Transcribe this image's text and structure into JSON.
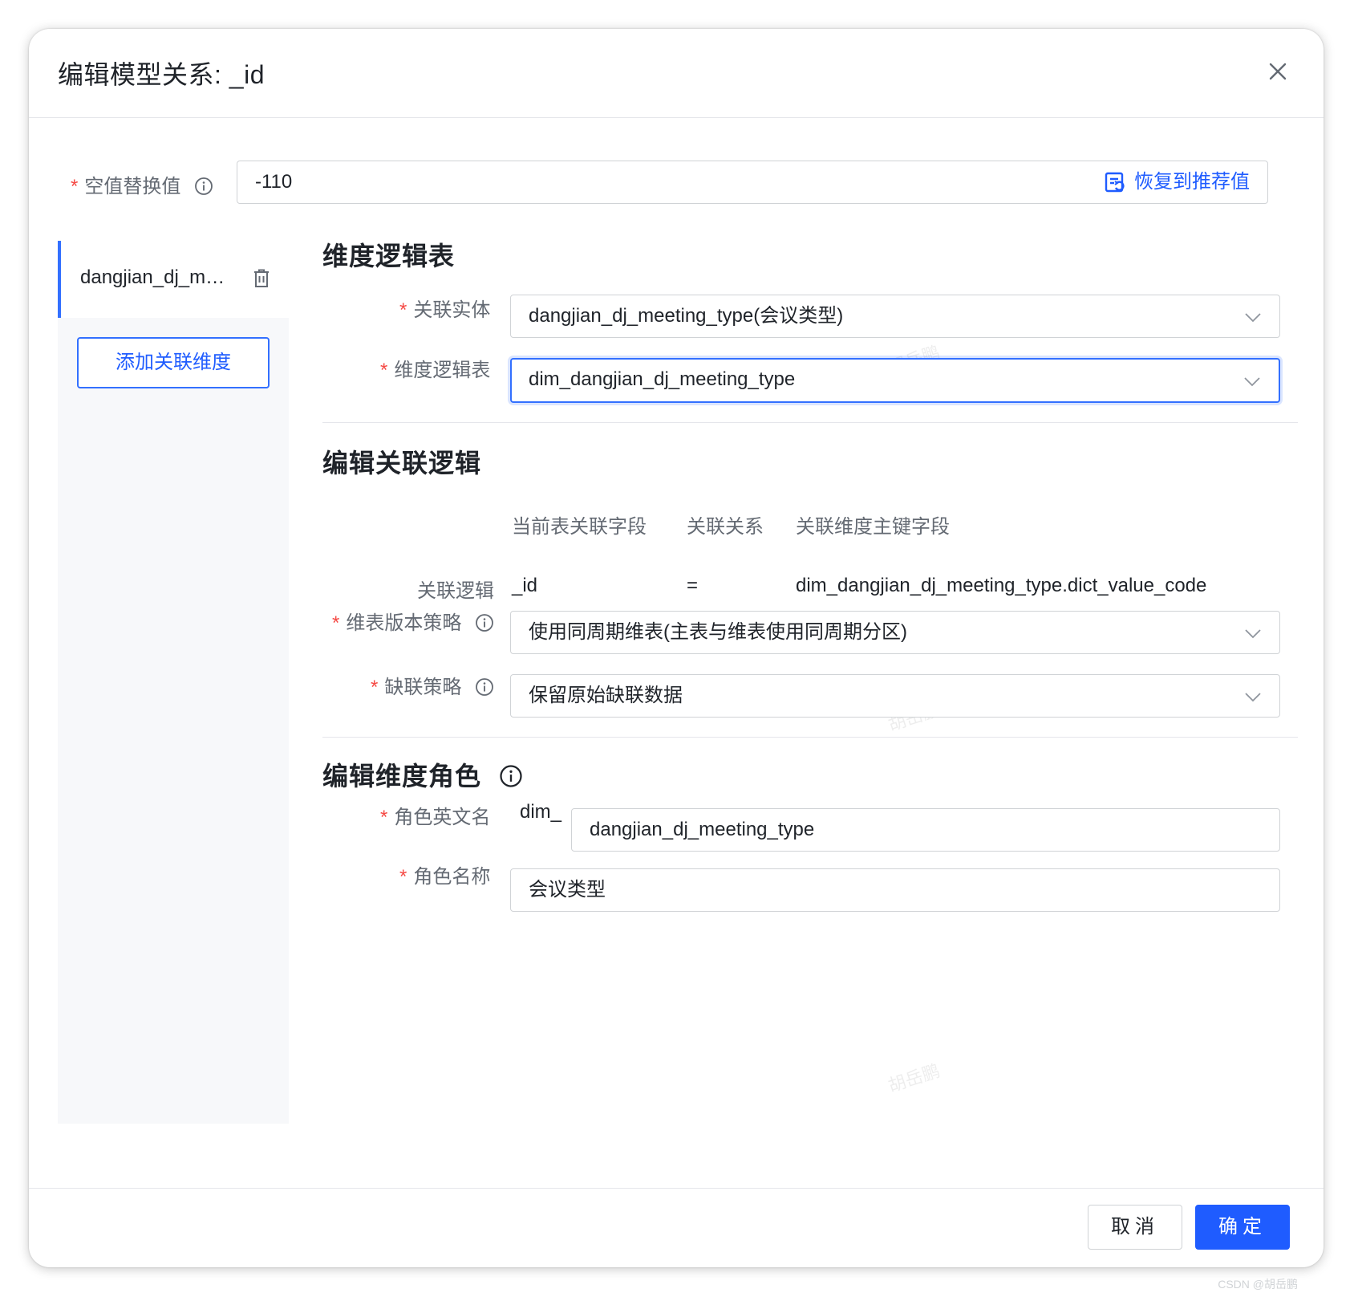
{
  "dialog": {
    "title": "编辑模型关系: _id"
  },
  "null_replace": {
    "label": "空值替换值",
    "value": "-110",
    "restore_label": "恢复到推荐值"
  },
  "sidebar": {
    "item_label": "dangjian_dj_m…",
    "add_label": "添加关联维度"
  },
  "dim_table_section": {
    "title": "维度逻辑表",
    "entity_label": "关联实体",
    "entity_value": "dangjian_dj_meeting_type(会议类型)",
    "table_label": "维度逻辑表",
    "table_value": "dim_dangjian_dj_meeting_type"
  },
  "logic_section": {
    "title": "编辑关联逻辑",
    "col_current_field": "当前表关联字段",
    "col_relation": "关联关系",
    "col_dim_key": "关联维度主键字段",
    "logic_label": "关联逻辑",
    "current_field": "_id",
    "relation": "=",
    "dim_key": "dim_dangjian_dj_meeting_type.dict_value_code",
    "version_label": "维表版本策略",
    "version_value": "使用同周期维表(主表与维表使用同周期分区)",
    "missing_label": "缺联策略",
    "missing_value": "保留原始缺联数据"
  },
  "role_section": {
    "title": "编辑维度角色",
    "en_name_label": "角色英文名",
    "en_prefix": "dim_",
    "en_value": "dangjian_dj_meeting_type",
    "name_label": "角色名称",
    "name_value": "会议类型"
  },
  "footer": {
    "cancel_label": "取消",
    "ok_label": "确定"
  },
  "watermark_text": "胡岳鹏",
  "credit": "CSDN @胡岳鹏",
  "colors": {
    "primary": "#3370ff",
    "primary_text": "#1f5cff",
    "required": "#f54a45",
    "border": "#d0d3d6",
    "label": "#646a73"
  }
}
